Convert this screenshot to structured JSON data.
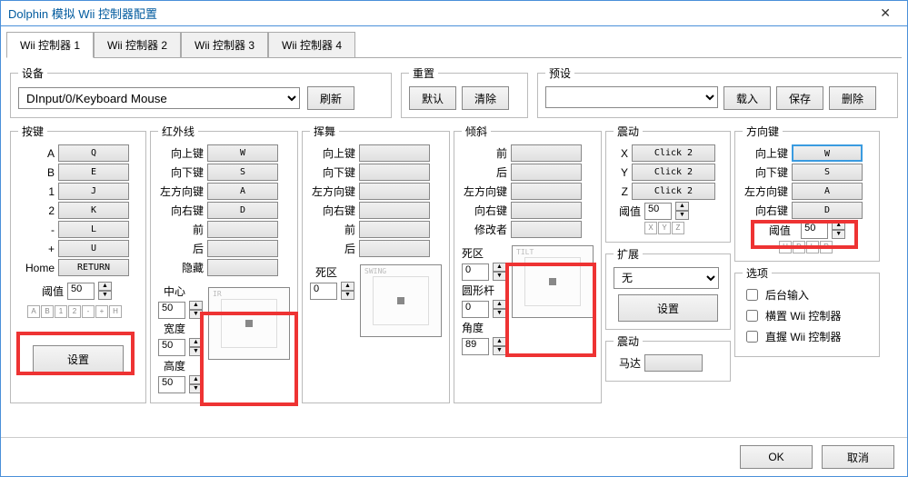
{
  "window_title": "Dolphin 模拟 Wii 控制器配置",
  "tabs": [
    "Wii 控制器 1",
    "Wii 控制器 2",
    "Wii 控制器 3",
    "Wii 控制器 4"
  ],
  "device": {
    "legend": "设备",
    "value": "DInput/0/Keyboard Mouse",
    "refresh": "刷新"
  },
  "reset": {
    "legend": "重置",
    "default_btn": "默认",
    "clear_btn": "清除"
  },
  "preset": {
    "legend": "预设",
    "value": "",
    "load_btn": "载入",
    "save_btn": "保存",
    "delete_btn": "删除"
  },
  "buttons": {
    "legend": "按键",
    "rows": [
      {
        "label": "A",
        "value": "Q"
      },
      {
        "label": "B",
        "value": "E"
      },
      {
        "label": "1",
        "value": "J"
      },
      {
        "label": "2",
        "value": "K"
      },
      {
        "label": "-",
        "value": "L"
      },
      {
        "label": "+",
        "value": "U"
      },
      {
        "label": "Home",
        "value": "RETURN"
      }
    ],
    "threshold_label": "阈值",
    "threshold_value": "50",
    "tiny": [
      "A",
      "B",
      "1",
      "2",
      "-",
      "+",
      "H"
    ],
    "settings_btn": "设置"
  },
  "ir": {
    "legend": "红外线",
    "rows": [
      {
        "label": "向上键",
        "value": "W"
      },
      {
        "label": "向下键",
        "value": "S"
      },
      {
        "label": "左方向键",
        "value": "A"
      },
      {
        "label": "向右键",
        "value": "D"
      },
      {
        "label": "前",
        "value": ""
      },
      {
        "label": "后",
        "value": ""
      },
      {
        "label": "隐藏",
        "value": ""
      }
    ],
    "center_label": "中心",
    "center_value": "50",
    "width_label": "宽度",
    "width_value": "50",
    "height_label": "高度",
    "height_value": "50",
    "pad_label": "IR"
  },
  "swing": {
    "legend": "挥舞",
    "rows": [
      {
        "label": "向上键",
        "value": ""
      },
      {
        "label": "向下键",
        "value": ""
      },
      {
        "label": "左方向键",
        "value": ""
      },
      {
        "label": "向右键",
        "value": ""
      },
      {
        "label": "前",
        "value": ""
      },
      {
        "label": "后",
        "value": ""
      }
    ],
    "deadzone_label": "死区",
    "deadzone_value": "0",
    "pad_label": "SWING"
  },
  "tilt": {
    "legend": "倾斜",
    "rows": [
      {
        "label": "前",
        "value": ""
      },
      {
        "label": "后",
        "value": ""
      },
      {
        "label": "左方向键",
        "value": ""
      },
      {
        "label": "向右键",
        "value": ""
      },
      {
        "label": "修改者",
        "value": ""
      }
    ],
    "deadzone_label": "死区",
    "deadzone_value": "0",
    "circle_label": "圆形杆",
    "circle_value": "0",
    "angle_label": "角度",
    "angle_value": "89",
    "pad_label": "TILT"
  },
  "rumble": {
    "legend": "震动",
    "rows": [
      {
        "label": "X",
        "value": "Click 2"
      },
      {
        "label": "Y",
        "value": "Click 2"
      },
      {
        "label": "Z",
        "value": "Click 2"
      }
    ],
    "threshold_label": "阈值",
    "threshold_value": "50",
    "tiny": [
      "X",
      "Y",
      "Z"
    ]
  },
  "extension": {
    "legend": "扩展",
    "value": "无",
    "settings_btn": "设置"
  },
  "motor": {
    "legend": "震动",
    "label": "马达",
    "value": ""
  },
  "dpad": {
    "legend": "方向键",
    "rows": [
      {
        "label": "向上键",
        "value": "W",
        "hl": true
      },
      {
        "label": "向下键",
        "value": "S"
      },
      {
        "label": "左方向键",
        "value": "A"
      },
      {
        "label": "向右键",
        "value": "D"
      }
    ],
    "threshold_label": "阈值",
    "threshold_value": "50",
    "tiny": [
      "U",
      "D",
      "L",
      "R"
    ]
  },
  "options": {
    "legend": "选项",
    "items": [
      "后台输入",
      "横置 Wii 控制器",
      "直握 Wii 控制器"
    ]
  },
  "footer": {
    "ok": "OK",
    "cancel": "取消"
  }
}
